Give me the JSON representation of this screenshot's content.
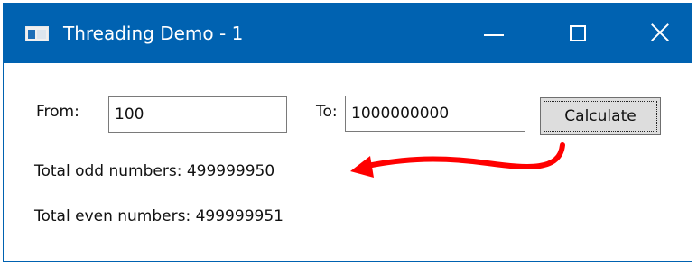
{
  "window": {
    "title": "Threading Demo - 1",
    "titlebar_color": "#0062b1",
    "icons": {
      "app": "app-window-icon",
      "minimize": "minimize-icon",
      "maximize": "maximize-icon",
      "close": "close-icon"
    }
  },
  "form": {
    "from_label": "From:",
    "from_value": "100",
    "to_label": "To:",
    "to_value": "1000000000",
    "calculate_label": "Calculate"
  },
  "results": {
    "odd_label": "Total odd numbers:",
    "odd_value": "499999950",
    "even_label": "Total even numbers:",
    "even_value": "499999951"
  },
  "annotation": {
    "arrow_color": "#ff0000",
    "arrow_icon": "red-curved-arrow"
  }
}
